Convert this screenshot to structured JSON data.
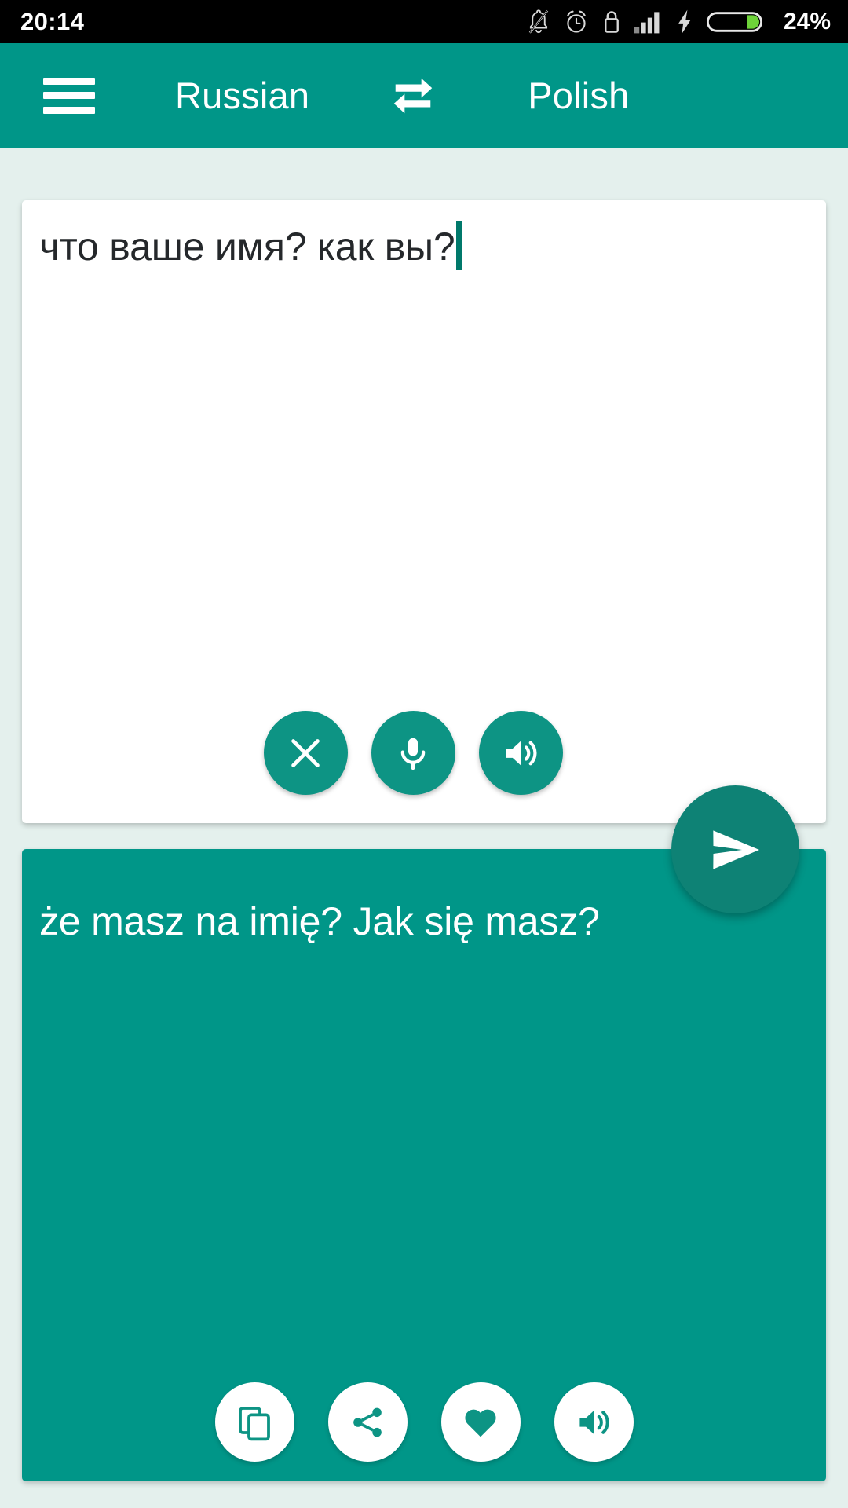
{
  "status_bar": {
    "time": "20:14",
    "battery_percent": "24%",
    "icons": [
      "bell-muted-icon",
      "alarm-clock-icon",
      "lock-icon",
      "signal-bars-icon",
      "charging-bolt-icon",
      "battery-icon"
    ]
  },
  "toolbar": {
    "menu_icon": "hamburger-menu-icon",
    "source_language": "Russian",
    "swap_icon": "swap-languages-icon",
    "target_language": "Polish"
  },
  "input_card": {
    "text": "что ваше имя? как вы?",
    "cursor_visible": true,
    "actions": [
      {
        "name": "clear-button",
        "icon": "close-icon"
      },
      {
        "name": "microphone-button",
        "icon": "microphone-icon"
      },
      {
        "name": "speak-source-button",
        "icon": "volume-icon"
      }
    ]
  },
  "send_button": {
    "name": "translate-send-button",
    "icon": "send-icon"
  },
  "output_card": {
    "text": "że masz na imię? Jak się masz?",
    "actions": [
      {
        "name": "copy-button",
        "icon": "copy-icon"
      },
      {
        "name": "share-button",
        "icon": "share-icon"
      },
      {
        "name": "favorite-button",
        "icon": "heart-icon"
      },
      {
        "name": "speak-translation-button",
        "icon": "volume-icon"
      }
    ]
  },
  "colors": {
    "primary": "#009688",
    "primary_dark": "#0e8275",
    "background": "#e4f0ed",
    "card": "#ffffff",
    "battery_fill": "#6ed33a"
  }
}
